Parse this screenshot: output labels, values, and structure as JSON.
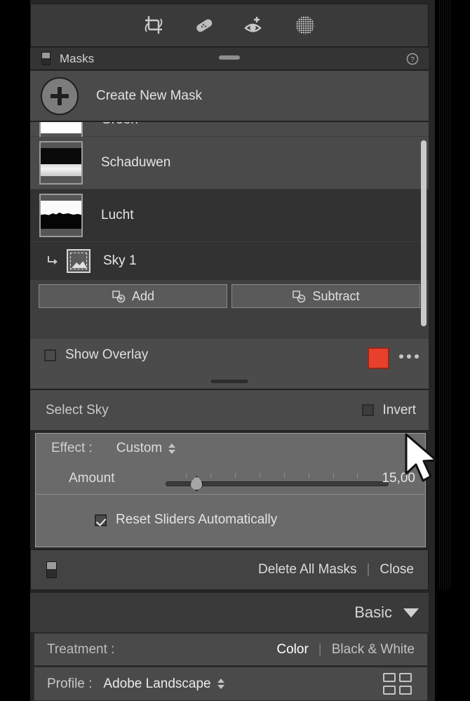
{
  "toolbar": {
    "tools": [
      {
        "name": "crop-tool",
        "icon": "crop-rotate-icon"
      },
      {
        "name": "healing-tool",
        "icon": "bandage-icon"
      },
      {
        "name": "redeye-tool",
        "icon": "eye-plus-icon"
      },
      {
        "name": "masking-tool",
        "icon": "dotted-circle-icon"
      }
    ]
  },
  "masks_panel": {
    "title": "Masks",
    "help_icon": "question-mark-icon",
    "toggle_icon": "panel-switch-icon",
    "create_new_mask": "Create New Mask",
    "mask_list": [
      {
        "name": "Groen",
        "selected": false,
        "clipped": true
      },
      {
        "name": "Schaduwen",
        "selected": false,
        "clipped": false
      },
      {
        "name": "Lucht",
        "selected": true,
        "clipped": false
      }
    ],
    "sub_mask": {
      "name": "Sky 1",
      "icon": "sky-select-icon"
    },
    "add_button": "Add",
    "subtract_button": "Subtract",
    "show_overlay": {
      "label": "Show Overlay",
      "checked": false
    },
    "overlay_color": "#e8402a",
    "more_options_icon": "ellipsis-icon",
    "select_sky": "Select Sky",
    "invert": {
      "label": "Invert",
      "checked": false
    }
  },
  "effect_panel": {
    "effect_label": "Effect :",
    "effect_value": "Custom",
    "amount_label": "Amount",
    "amount_value": "15,00",
    "amount_percent": 15,
    "reset_sliders": {
      "label": "Reset Sliders Automatically",
      "checked": true
    }
  },
  "bottom_bar": {
    "toggle_icon": "panel-switch-icon",
    "delete_all_masks": "Delete All Masks",
    "separator": "|",
    "close": "Close"
  },
  "basic_panel": {
    "title": "Basic",
    "collapse_icon": "triangle-down-icon",
    "treatment_label": "Treatment :",
    "treatment_color": "Color",
    "treatment_separator": "|",
    "treatment_bw": "Black & White",
    "profile_label": "Profile :",
    "profile_value": "Adobe Landscape",
    "profile_browser_icon": "grid-four-icon"
  }
}
